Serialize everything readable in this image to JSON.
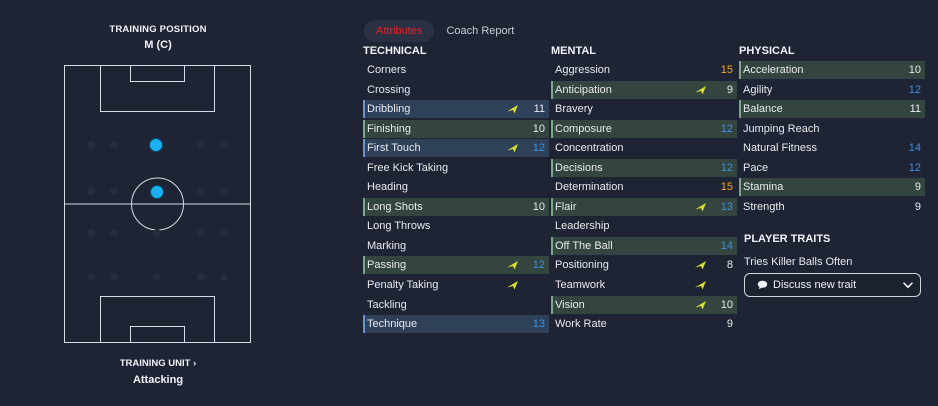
{
  "left": {
    "training_position_title": "TRAINING POSITION",
    "training_position_value": "M (C)",
    "training_unit_title": "TRAINING UNIT ›",
    "training_unit_value": "Attacking"
  },
  "tabs": [
    {
      "label": "Attributes",
      "active": true
    },
    {
      "label": "Coach Report",
      "active": false
    }
  ],
  "colors": {
    "background": "#1f2434",
    "active_tab_text": "#e0242e",
    "value_blue": "#3f8fe0",
    "value_orange": "#f0a830",
    "arrow_yellow": "#d8e22a",
    "player_dot": "#1ab0f0"
  },
  "technical": {
    "heading": "TECHNICAL",
    "rows": [
      {
        "name": "Corners",
        "value": "",
        "color": "white",
        "hl": "",
        "arrow": false
      },
      {
        "name": "Crossing",
        "value": "",
        "color": "white",
        "hl": "",
        "arrow": false
      },
      {
        "name": "Dribbling",
        "value": "11",
        "color": "white",
        "hl": "blue",
        "arrow": true
      },
      {
        "name": "Finishing",
        "value": "10",
        "color": "white",
        "hl": "green",
        "arrow": false
      },
      {
        "name": "First Touch",
        "value": "12",
        "color": "blue",
        "hl": "blue",
        "arrow": true
      },
      {
        "name": "Free Kick Taking",
        "value": "",
        "color": "white",
        "hl": "",
        "arrow": false
      },
      {
        "name": "Heading",
        "value": "",
        "color": "white",
        "hl": "",
        "arrow": false
      },
      {
        "name": "Long Shots",
        "value": "10",
        "color": "white",
        "hl": "green",
        "arrow": false
      },
      {
        "name": "Long Throws",
        "value": "",
        "color": "white",
        "hl": "",
        "arrow": false
      },
      {
        "name": "Marking",
        "value": "",
        "color": "white",
        "hl": "",
        "arrow": false
      },
      {
        "name": "Passing",
        "value": "12",
        "color": "blue",
        "hl": "green",
        "arrow": true
      },
      {
        "name": "Penalty Taking",
        "value": "",
        "color": "white",
        "hl": "",
        "arrow": true
      },
      {
        "name": "Tackling",
        "value": "",
        "color": "white",
        "hl": "",
        "arrow": false
      },
      {
        "name": "Technique",
        "value": "13",
        "color": "blue",
        "hl": "blue",
        "arrow": false
      }
    ]
  },
  "mental": {
    "heading": "MENTAL",
    "rows": [
      {
        "name": "Aggression",
        "value": "15",
        "color": "orange",
        "hl": "",
        "arrow": false
      },
      {
        "name": "Anticipation",
        "value": "9",
        "color": "white",
        "hl": "green",
        "arrow": true
      },
      {
        "name": "Bravery",
        "value": "",
        "color": "white",
        "hl": "",
        "arrow": false
      },
      {
        "name": "Composure",
        "value": "12",
        "color": "blue",
        "hl": "green",
        "arrow": false
      },
      {
        "name": "Concentration",
        "value": "",
        "color": "white",
        "hl": "",
        "arrow": false
      },
      {
        "name": "Decisions",
        "value": "12",
        "color": "blue",
        "hl": "green",
        "arrow": false
      },
      {
        "name": "Determination",
        "value": "15",
        "color": "orange",
        "hl": "",
        "arrow": false
      },
      {
        "name": "Flair",
        "value": "13",
        "color": "blue",
        "hl": "green",
        "arrow": true
      },
      {
        "name": "Leadership",
        "value": "",
        "color": "white",
        "hl": "",
        "arrow": false
      },
      {
        "name": "Off The Ball",
        "value": "14",
        "color": "blue",
        "hl": "green",
        "arrow": false
      },
      {
        "name": "Positioning",
        "value": "8",
        "color": "white",
        "hl": "",
        "arrow": true
      },
      {
        "name": "Teamwork",
        "value": "",
        "color": "white",
        "hl": "",
        "arrow": true
      },
      {
        "name": "Vision",
        "value": "10",
        "color": "white",
        "hl": "green",
        "arrow": true
      },
      {
        "name": "Work Rate",
        "value": "9",
        "color": "white",
        "hl": "",
        "arrow": false
      }
    ]
  },
  "physical": {
    "heading": "PHYSICAL",
    "rows": [
      {
        "name": "Acceleration",
        "value": "10",
        "color": "white",
        "hl": "green",
        "arrow": false
      },
      {
        "name": "Agility",
        "value": "12",
        "color": "blue",
        "hl": "",
        "arrow": false
      },
      {
        "name": "Balance",
        "value": "11",
        "color": "white",
        "hl": "green",
        "arrow": false
      },
      {
        "name": "Jumping Reach",
        "value": "",
        "color": "white",
        "hl": "",
        "arrow": false
      },
      {
        "name": "Natural Fitness",
        "value": "14",
        "color": "blue",
        "hl": "",
        "arrow": false
      },
      {
        "name": "Pace",
        "value": "12",
        "color": "blue",
        "hl": "",
        "arrow": false
      },
      {
        "name": "Stamina",
        "value": "9",
        "color": "white",
        "hl": "green",
        "arrow": false
      },
      {
        "name": "Strength",
        "value": "9",
        "color": "white",
        "hl": "",
        "arrow": false
      }
    ]
  },
  "traits": {
    "heading": "PLAYER TRAITS",
    "items": [
      "Tries Killer Balls Often"
    ],
    "discuss_label": "Discuss new trait",
    "discuss_icon": "speech-bubble-icon",
    "dropdown_icon": "chevron-down-icon"
  }
}
